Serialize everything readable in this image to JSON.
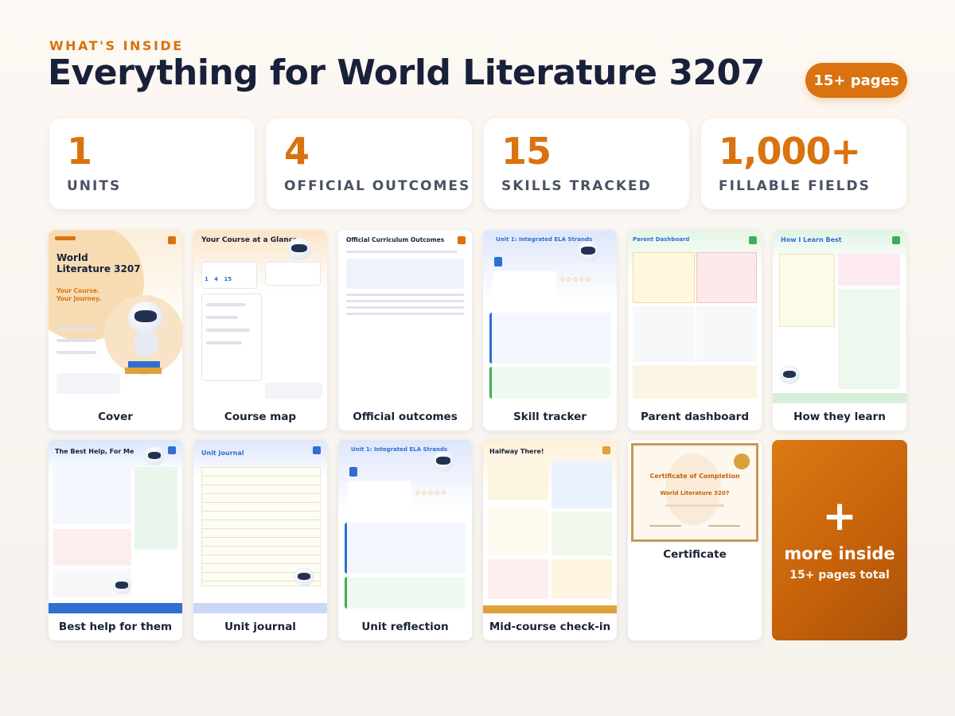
{
  "header": {
    "eyebrow": "WHAT'S INSIDE",
    "title": "Everything for World Literature 3207",
    "pages_badge": "15+ pages"
  },
  "stats": [
    {
      "value": "1",
      "label": "UNITS"
    },
    {
      "value": "4",
      "label": "OFFICIAL OUTCOMES"
    },
    {
      "value": "15",
      "label": "SKILLS TRACKED"
    },
    {
      "value": "1,000+",
      "label": "FILLABLE FIELDS"
    }
  ],
  "cards": [
    {
      "caption": "Cover",
      "thumb_title": "World Literature 3207",
      "thumb_sub": "Your Course. Your Journey."
    },
    {
      "caption": "Course map",
      "thumb_title": "Your Course at a Glance"
    },
    {
      "caption": "Official outcomes",
      "thumb_title": "Official Curriculum Outcomes"
    },
    {
      "caption": "Skill tracker",
      "thumb_title": "Unit 1: Integrated ELA Strands"
    },
    {
      "caption": "Parent dashboard",
      "thumb_title": "Parent Dashboard"
    },
    {
      "caption": "How they learn",
      "thumb_title": "How I Learn Best"
    },
    {
      "caption": "Best help for them",
      "thumb_title": "The Best Help, For Me"
    },
    {
      "caption": "Unit journal",
      "thumb_title": "Unit Journal"
    },
    {
      "caption": "Unit reflection",
      "thumb_title": "Unit 1: Integrated ELA Strands"
    },
    {
      "caption": "Mid-course check-in",
      "thumb_title": "Halfway There!"
    },
    {
      "caption": "Certificate",
      "thumb_title": "Certificate of Completion",
      "thumb_sub": "World Literature 3207"
    }
  ],
  "more": {
    "plus": "+",
    "label": "more inside",
    "sub": "15+ pages total"
  },
  "colors": {
    "accent": "#d9720f",
    "title": "#18203a",
    "label": "#4a5265"
  }
}
